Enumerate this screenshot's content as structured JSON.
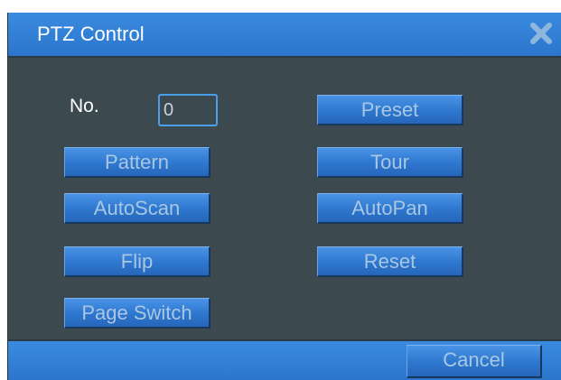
{
  "window": {
    "title": "PTZ Control",
    "close_icon": "close-icon"
  },
  "fields": {
    "no_label": "No.",
    "no_value": "0"
  },
  "buttons": {
    "preset": "Preset",
    "pattern": "Pattern",
    "tour": "Tour",
    "autoscan": "AutoScan",
    "autopan": "AutoPan",
    "flip": "Flip",
    "reset": "Reset",
    "page_switch": "Page Switch"
  },
  "footer": {
    "cancel": "Cancel"
  },
  "colors": {
    "title_bar": "#2f7fd6",
    "body": "#3c4a50",
    "button": "#2f79d0",
    "button_text": "#a9c6e3",
    "input_border": "#4aa0e8"
  }
}
